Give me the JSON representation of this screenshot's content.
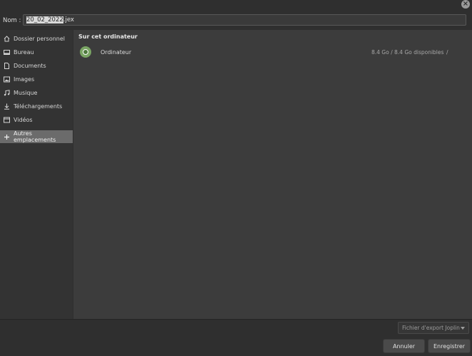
{
  "header": {
    "name_label": "Nom :",
    "filename_selected": "20_02_2022",
    "filename_ext": ".jex",
    "close_glyph": "×"
  },
  "sidebar": {
    "items": [
      {
        "label": "Dossier personnel",
        "icon": "home-icon"
      },
      {
        "label": "Bureau",
        "icon": "desktop-icon"
      },
      {
        "label": "Documents",
        "icon": "document-icon"
      },
      {
        "label": "Images",
        "icon": "image-icon"
      },
      {
        "label": "Musique",
        "icon": "music-icon"
      },
      {
        "label": "Téléchargements",
        "icon": "download-icon"
      },
      {
        "label": "Vidéos",
        "icon": "video-icon"
      },
      {
        "label": "Autres emplacements",
        "icon": "plus-icon",
        "active": true
      }
    ]
  },
  "main": {
    "section_title": "Sur cet ordinateur",
    "rows": [
      {
        "name": "Ordinateur",
        "space": "8.4 Go / 8.4 Go disponibles",
        "path": "/",
        "icon": "drive-icon"
      }
    ]
  },
  "footer": {
    "filter_value": "Fichier d'export Joplin",
    "cancel_label": "Annuler",
    "save_label": "Enregistrer"
  },
  "colors": {
    "background": "#2f2f2f",
    "sidebar": "#333333",
    "main": "#3c3c3c",
    "active_item": "#6b6b6b",
    "drive_accent": "#7aa564"
  }
}
